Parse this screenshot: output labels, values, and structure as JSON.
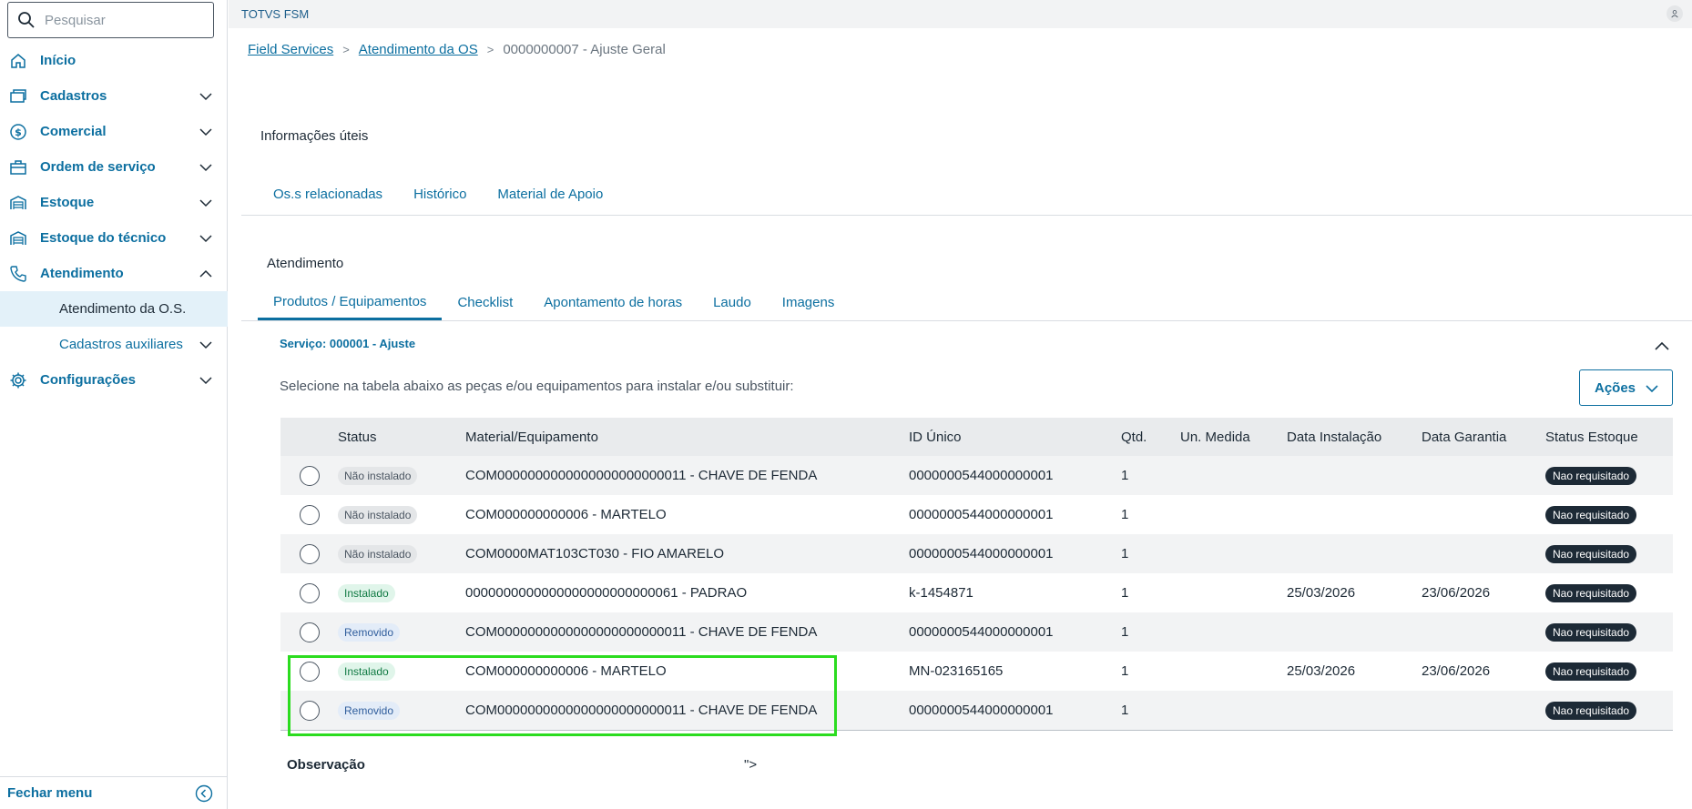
{
  "search": {
    "placeholder": "Pesquisar"
  },
  "sidebar": {
    "items": [
      {
        "label": "Início",
        "icon": "home-icon"
      },
      {
        "label": "Cadastros",
        "icon": "cards-icon"
      },
      {
        "label": "Comercial",
        "icon": "dollar-icon"
      },
      {
        "label": "Ordem de serviço",
        "icon": "briefcase-icon"
      },
      {
        "label": "Estoque",
        "icon": "warehouse-icon"
      },
      {
        "label": "Estoque do técnico",
        "icon": "warehouse-icon"
      },
      {
        "label": "Atendimento",
        "icon": "phone-icon"
      },
      {
        "label": "Configurações",
        "icon": "gear-icon"
      }
    ],
    "sub_items": [
      {
        "label": "Atendimento da O.S."
      },
      {
        "label": "Cadastros auxiliares"
      }
    ],
    "footer_label": "Fechar menu"
  },
  "topbar": {
    "app_title": "TOTVS FSM"
  },
  "breadcrumb": {
    "items": [
      "Field Services",
      "Atendimento da OS"
    ],
    "current": "0000000007 - Ajuste Geral"
  },
  "info": {
    "title": "Informações úteis",
    "tabs": [
      "Os.s relacionadas",
      "Histórico",
      "Material de Apoio"
    ]
  },
  "atendimento": {
    "title": "Atendimento",
    "tabs": [
      "Produtos / Equipamentos",
      "Checklist",
      "Apontamento de horas",
      "Laudo",
      "Imagens"
    ],
    "active_tab": "Produtos / Equipamentos"
  },
  "service": {
    "title": "Serviço: 000001 - Ajuste",
    "instruction": "Selecione na tabela abaixo as peças e/ou equipamentos para instalar e/ou substituir:",
    "actions_label": "Ações"
  },
  "table": {
    "headers": [
      "Status",
      "Material/Equipamento",
      "ID Único",
      "Qtd.",
      "Un. Medida",
      "Data Instalação",
      "Data Garantia",
      "Status Estoque"
    ],
    "rows": [
      {
        "status": "Não instalado",
        "material": "COM0000000000000000000000011 - CHAVE DE FENDA",
        "id": "0000000544000000001",
        "qtd": "1",
        "un": "",
        "data_inst": "",
        "data_gar": "",
        "estoque": "Nao requisitado"
      },
      {
        "status": "Não instalado",
        "material": "COM000000000006 - MARTELO",
        "id": "0000000544000000001",
        "qtd": "1",
        "un": "",
        "data_inst": "",
        "data_gar": "",
        "estoque": "Nao requisitado"
      },
      {
        "status": "Não instalado",
        "material": "COM0000MAT103CT030 - FIO AMARELO",
        "id": "0000000544000000001",
        "qtd": "1",
        "un": "",
        "data_inst": "",
        "data_gar": "",
        "estoque": "Nao requisitado"
      },
      {
        "status": "Instalado",
        "material": "0000000000000000000000000061 - PADRAO",
        "id": "k-1454871",
        "qtd": "1",
        "un": "",
        "data_inst": "25/03/2026",
        "data_gar": "23/06/2026",
        "estoque": "Nao requisitado"
      },
      {
        "status": "Removido",
        "material": "COM0000000000000000000000011 - CHAVE DE FENDA",
        "id": "0000000544000000001",
        "qtd": "1",
        "un": "",
        "data_inst": "",
        "data_gar": "",
        "estoque": "Nao requisitado"
      },
      {
        "status": "Instalado",
        "material": "COM000000000006 - MARTELO",
        "id": "MN-023165165",
        "qtd": "1",
        "un": "",
        "data_inst": "25/03/2026",
        "data_gar": "23/06/2026",
        "estoque": "Nao requisitado"
      },
      {
        "status": "Removido",
        "material": "COM0000000000000000000000011 - CHAVE DE FENDA",
        "id": "0000000544000000001",
        "qtd": "1",
        "un": "",
        "data_inst": "",
        "data_gar": "",
        "estoque": "Nao requisitado"
      }
    ]
  },
  "observacao": {
    "label": "Observação",
    "value": "\">"
  },
  "colors": {
    "primary": "#0c6fa0",
    "highlight": "#2bdc1f",
    "badge_dark": "#1d2a36"
  }
}
